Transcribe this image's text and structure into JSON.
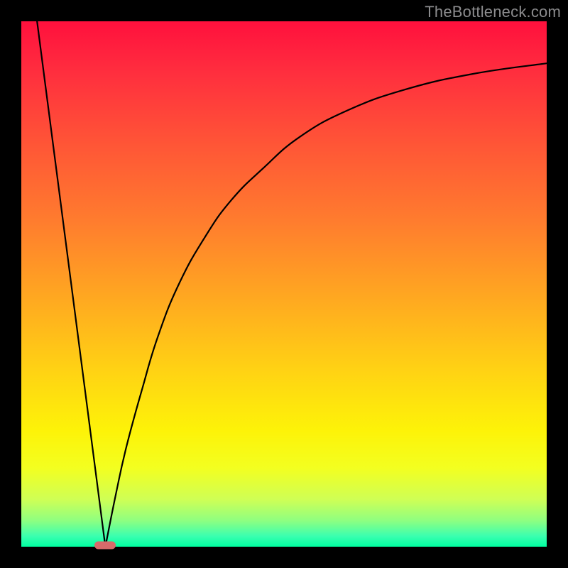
{
  "watermark": "TheBottleneck.com",
  "chart_data": {
    "type": "line",
    "title": "",
    "xlabel": "",
    "ylabel": "",
    "xlim": [
      0,
      100
    ],
    "ylim": [
      0,
      100
    ],
    "grid": false,
    "legend": false,
    "background": "vertical-gradient red→orange→yellow→green",
    "series": [
      {
        "name": "left-line",
        "x": [
          3,
          16
        ],
        "y": [
          100,
          0
        ]
      },
      {
        "name": "right-curve",
        "x": [
          16,
          18,
          20,
          23,
          26,
          30,
          35,
          40,
          46,
          53,
          62,
          73,
          86,
          100
        ],
        "y": [
          0,
          10,
          19,
          30,
          40,
          50,
          59,
          66,
          72,
          78,
          83,
          87,
          90,
          92
        ]
      }
    ],
    "annotations": [
      {
        "name": "bottleneck-marker",
        "shape": "rounded-rect",
        "x": 16,
        "y": 0,
        "color": "#d86a6a"
      }
    ]
  }
}
